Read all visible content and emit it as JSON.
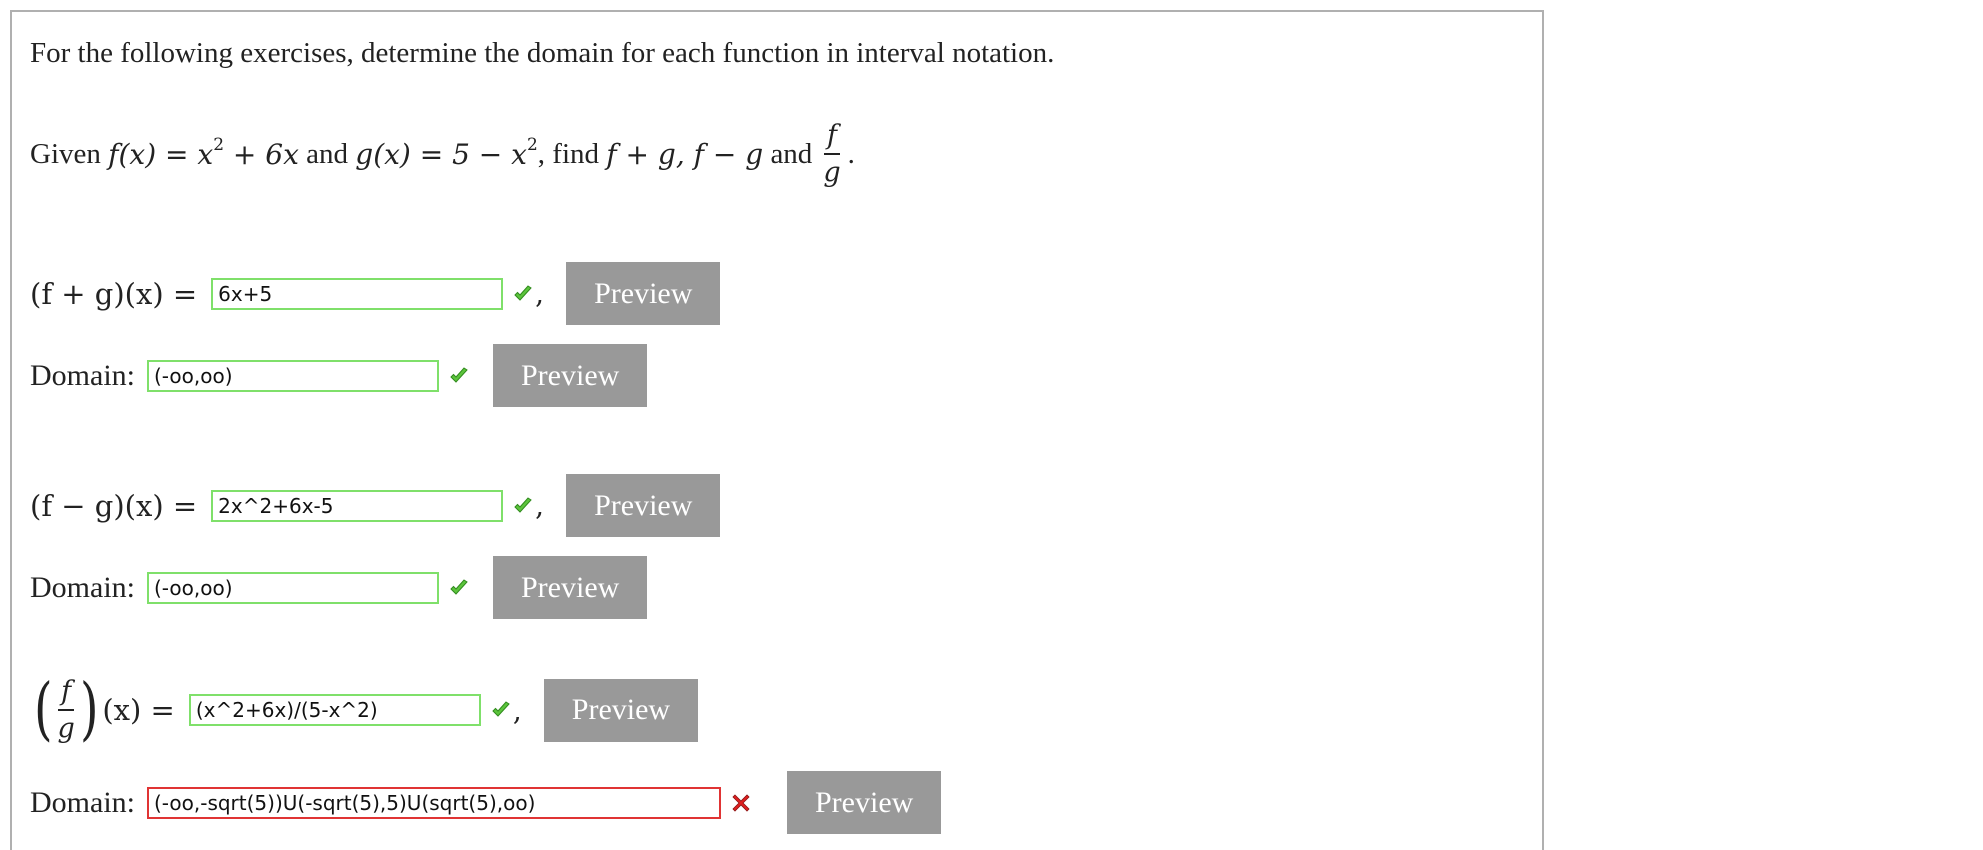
{
  "problem": {
    "instructions": "For the following exercises, determine the domain for each function in interval notation.",
    "given_prefix": "Given",
    "f_def": "f(x) = x",
    "f_exp": "2",
    "f_rest": " + 6x",
    "and1": "and",
    "g_def": "g(x) = 5 − x",
    "g_exp": "2",
    "find": ", find",
    "sum_expr": "f + g",
    "diff_expr": ", f − g",
    "and2": "and",
    "frac_num": "f",
    "frac_den": "g",
    "period": "."
  },
  "parts": [
    {
      "label": "(f + g)(x) =",
      "answer": "6x+5",
      "answer_status": "correct",
      "comma": ",",
      "preview_label": "Preview",
      "domain_label": "Domain:",
      "domain_value": "(-oo,oo)",
      "domain_status": "correct",
      "domain_preview_label": "Preview"
    },
    {
      "label": "(f − g)(x) =",
      "answer": "2x^2+6x-5",
      "answer_status": "correct",
      "comma": ",",
      "preview_label": "Preview",
      "domain_label": "Domain:",
      "domain_value": "(-oo,oo)",
      "domain_status": "correct",
      "domain_preview_label": "Preview"
    },
    {
      "label_num": "f",
      "label_den": "g",
      "label_tail": "(x) =",
      "answer": "(x^2+6x)/(5-x^2)",
      "answer_status": "correct",
      "comma": ",",
      "preview_label": "Preview",
      "domain_label": "Domain:",
      "domain_value": "(-oo,-sqrt(5))U(-sqrt(5),5)U(sqrt(5),oo)",
      "domain_status": "incorrect",
      "domain_preview_label": "Preview"
    }
  ],
  "colors": {
    "correct_border": "#7fe06a",
    "incorrect_border": "#e03434",
    "check_fill": "#5cc43c",
    "cross_fill": "#e02020",
    "preview_bg": "#999999"
  },
  "icons": {
    "correct": "check-icon",
    "incorrect": "cross-icon"
  }
}
